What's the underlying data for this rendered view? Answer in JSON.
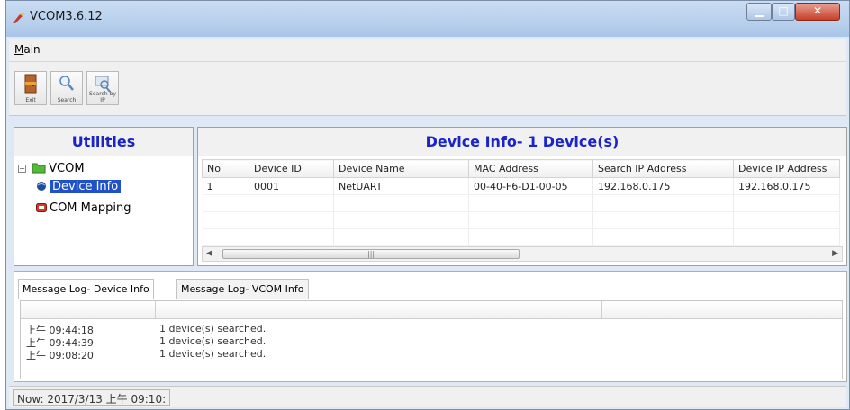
{
  "window": {
    "title": "VCOM3.6.12"
  },
  "menu": {
    "main_prefix": "M",
    "main_rest": "ain"
  },
  "toolbar": [
    {
      "label": "Exit",
      "icon": "exit-door-icon"
    },
    {
      "label": "Search",
      "icon": "search-icon"
    },
    {
      "label": "Search by IP",
      "icon": "search-by-ip-icon"
    }
  ],
  "utilities": {
    "title": "Utilities",
    "root": "VCOM",
    "items": [
      "Device Info",
      "COM Mapping"
    ],
    "selected": "Device Info"
  },
  "device_info": {
    "title": "Device Info- 1 Device(s)",
    "columns": [
      "No",
      "Device ID",
      "Device Name",
      "MAC Address",
      "Search IP Address",
      "Device IP Address"
    ],
    "rows": [
      [
        "1",
        "0001",
        "NetUART",
        "00-40-F6-D1-00-05",
        "192.168.0.175",
        "192.168.0.175"
      ]
    ]
  },
  "message_log": {
    "tabs": [
      "Message Log- Device Info",
      "Message Log- VCOM Info"
    ],
    "active_tab": "Message Log- Device Info",
    "entries": [
      {
        "time": "上午 09:44:18",
        "message": "1 device(s) searched."
      },
      {
        "time": "上午 09:44:39",
        "message": "1 device(s) searched."
      },
      {
        "time": "上午 09:08:20",
        "message": "1 device(s) searched."
      }
    ]
  },
  "status": {
    "text": "Now: 2017/3/13 上午 09:10:"
  },
  "colors": {
    "header_title": "#1a24c9",
    "selection": "#1f52c9",
    "close_button": "#c7402a"
  }
}
